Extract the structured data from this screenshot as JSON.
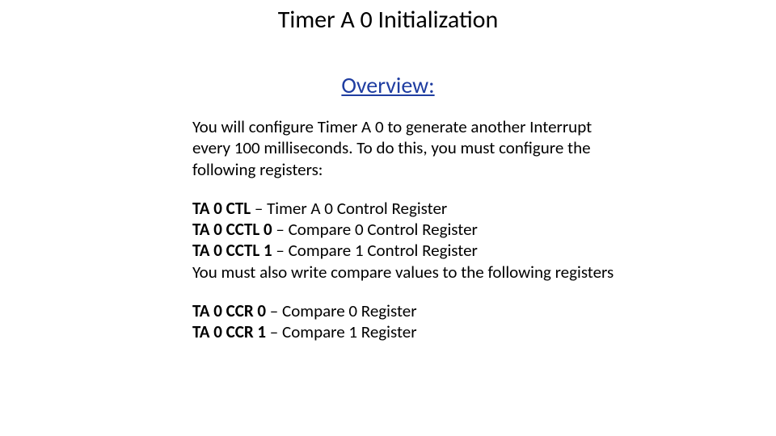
{
  "title": "Timer A 0 Initialization",
  "subtitle": "Overview:",
  "intro": "You will configure Timer A 0 to generate another Interrupt every 100 milliseconds. To do this, you must configure the following registers:",
  "regs1": {
    "r1_name": "TA 0 CTL",
    "r1_desc": " – Timer A 0 Control Register",
    "r2_name": "TA 0 CCTL 0",
    "r2_desc": " – Compare  0 Control Register",
    "r3_name": "TA 0 CCTL 1",
    "r3_desc": " – Compare 1 Control Register",
    "tail": "You must also write compare values to the following registers"
  },
  "regs2": {
    "r4_name": "TA 0 CCR 0",
    "r4_desc": " – Compare 0 Register",
    "r5_name": "TA 0 CCR 1",
    "r5_desc": " – Compare 1 Register"
  }
}
